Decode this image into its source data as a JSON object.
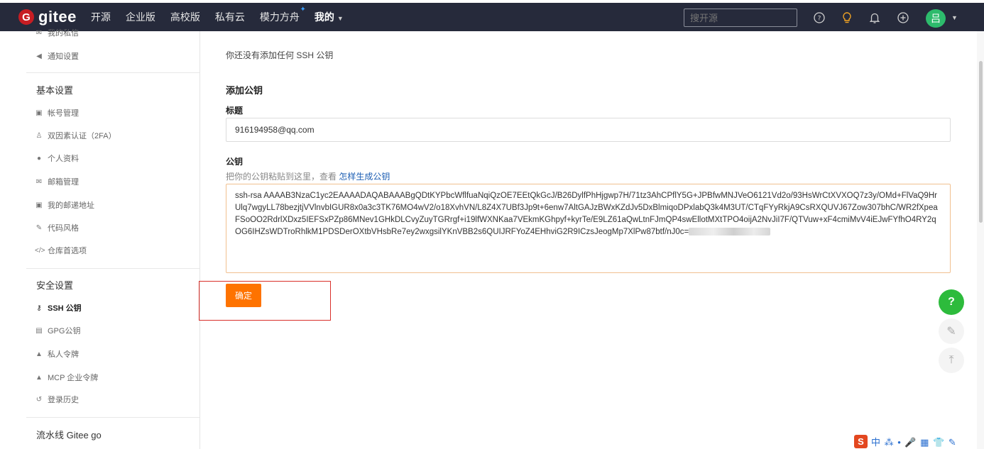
{
  "topbar": {
    "logo_text": "gitee",
    "logo_mark": "G",
    "nav": [
      "开源",
      "企业版",
      "高校版",
      "私有云",
      "模力方舟"
    ],
    "my_label": "我的",
    "search_placeholder": "搜开源",
    "avatar_text": "吕"
  },
  "sidebar": {
    "partial_top": "我的私信",
    "notify": "通知设置",
    "basic_head": "基本设置",
    "basic_items": [
      "帐号管理",
      "双因素认证（2FA）",
      "个人资料",
      "邮箱管理",
      "我的邮递地址",
      "代码风格",
      "仓库首选项"
    ],
    "security_head": "安全设置",
    "security_items": [
      "SSH 公钥",
      "GPG公钥",
      "私人令牌",
      "MCP 企业令牌",
      "登录历史"
    ],
    "pipeline_head": "流水线 Gitee go"
  },
  "main": {
    "empty_msg": "你还没有添加任何 SSH 公钥",
    "section_title": "添加公钥",
    "title_label": "标题",
    "title_value": "916194958@qq.com",
    "key_label": "公钥",
    "key_hint": "把你的公钥粘贴到这里，查看",
    "key_hint_link": "怎样生成公钥",
    "key_value": "ssh-rsa AAAAB3NzaC1yc2EAAAADAQABAAABgQDtKYPbcWflfuaNqiQzOE7EEtQkGcJ/B26DylfPhHjgwp7H/71tz3AhCPflY5G+JPBfwMNJVeO6121Vd2o/93HsWrCtXVXOQ7z3y/OMd+FlVaQ9HrUlq7wgyLL78bezjtjVVlnvbIGUR8x0a3c3TK76MO4wV2/o18XvhVN/L8Z4X7UBf3Jp9t+6enw7AltGAJzBWxKZdJv5DxBlmiqoDPxlabQ3k4M3UT/CTqFYyRkjA9CsRXQUVJ67Zow307bhC/WR2fXpeaFSoOO2RdrlXDxz5IEFSxPZp86MNev1GHkDLCvyZuyTGRrgf+i19lfWXNKaa7VEkmKGhpyf+kyrTe/E9LZ61aQwLtnFJmQP4swEllotMXtTPO4oijA2NvJiI7F/QTVuw+xF4cmiMvV4iEJwFYfhO4RY2qOG6IHZsWDTroRhlkM1PDSDerOXtbVHsbRe7ey2wxgsilYKnVBB2s6QUIJRFYoZ4EHhviG2R9ICzsJeogMp7XlPw87btf/nJ0c=",
    "confirm": "确定"
  },
  "floating": {
    "help": "?",
    "edit": "✎",
    "top": "⤒"
  },
  "ime": {
    "logo": "S",
    "rest": "中 ⁂ • 🎤 ▦ 👕 ✎"
  },
  "colors": {
    "topbar": "#262a3b",
    "accent": "#fe7300",
    "link": "#1e5fb4",
    "success": "#2dbb3c"
  }
}
